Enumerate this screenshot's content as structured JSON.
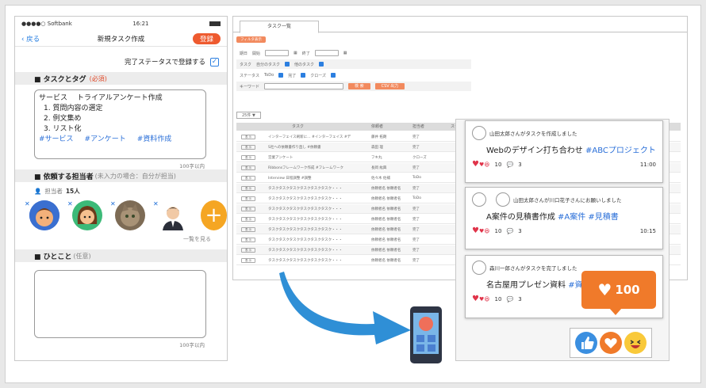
{
  "phone": {
    "status": {
      "carrier": "●●●●○ Softbank",
      "time": "16:21"
    },
    "nav": {
      "back": "戻る",
      "title": "新規タスク作成",
      "register": "登録"
    },
    "register_complete_label": "完了ステータスで登録する",
    "section_task": {
      "title": "■ タスクとタグ",
      "required": "(必須)"
    },
    "task_text": {
      "service_label": "サービス",
      "service_value": "トライアルアンケート作成",
      "items": [
        "1. 質問内容の選定",
        "2. 例文集め",
        "3. リスト化"
      ],
      "tags": [
        "#サービス",
        "#アンケート",
        "#資料作成"
      ]
    },
    "char_limit": "100字以内",
    "section_assignee": {
      "title": "■ 依頼する担当者",
      "note": "(未入力の場合：自分が担当)"
    },
    "assignee_count_label": "担当者",
    "assignee_count": "15人",
    "view_all": "一覧を見る",
    "section_comment": {
      "title": "■ ひとこと",
      "note": "(任意)"
    },
    "comment_limit": "100字以内"
  },
  "web": {
    "tab": "タスク一覧",
    "top_button": "フィルタ表示",
    "filters": {
      "date_label": "期日",
      "start": "開始",
      "end": "終了",
      "task_label": "タスク",
      "task_opt1": "自分のタスク",
      "task_opt2": "他のタスク",
      "status_label": "ステータス",
      "status_opt1": "ToDo",
      "status_opt2": "完了",
      "status_opt3": "クローズ",
      "keyword_label": "キーワード",
      "search": "検 索",
      "csv": "CSV 出力"
    },
    "page_label": "25件 ▼",
    "table": {
      "headers": [
        "タスク",
        "依頼者",
        "担当者",
        "ステータス"
      ],
      "btn": "表 示",
      "rows": [
        {
          "task": "インターフェイス刷新に… #インターフェイス #デ",
          "req": "藤井 拓朗",
          "st": "完了"
        },
        {
          "task": "S社への依頼書作り直し #依頼書",
          "req": "森田 理",
          "st": "完了"
        },
        {
          "task": "営業アンケート",
          "req": "フキ丸",
          "st": "クローズ"
        },
        {
          "task": "Ribbonsフレームワーク作成 #フレームワーク",
          "req": "長岡 紘興",
          "st": "完了"
        },
        {
          "task": "Interview 日程調整 #調整",
          "req": "佐々木 佐補",
          "st": "ToDo"
        },
        {
          "task": "タスクタスクタスクタスクタスクタスク・・・",
          "req": "依頼者名 依頼者名",
          "st": "完了"
        },
        {
          "task": "タスクタスクタスクタスクタスクタスク・・・",
          "req": "依頼者名 依頼者名",
          "st": "ToDo"
        },
        {
          "task": "タスクタスクタスクタスクタスクタスク・・・",
          "req": "依頼者名 依頼者名",
          "st": "完了"
        },
        {
          "task": "タスクタスクタスクタスクタスクタスク・・・",
          "req": "依頼者名 依頼者名",
          "st": "完了"
        },
        {
          "task": "タスクタスクタスクタスクタスクタスク・・・",
          "req": "依頼者名 依頼者名",
          "st": "完了"
        },
        {
          "task": "タスクタスクタスクタスクタスクタスク・・・",
          "req": "依頼者名 依頼者名",
          "st": "完了"
        },
        {
          "task": "タスクタスクタスクタスクタスクタスク・・・",
          "req": "依頼者名 依頼者名",
          "st": "完了"
        },
        {
          "task": "タスクタスクタスクタスクタスクタスク・・・",
          "req": "依頼者名 依頼者名",
          "st": "完了"
        }
      ]
    }
  },
  "cards": [
    {
      "actor": "山田太郎さんがタスクを作成しました",
      "title": "Webのデザイン打ち合わせ",
      "tag": "#ABCプロジェクト",
      "likes": "10",
      "comments": "3",
      "time": "11:00"
    },
    {
      "actor": "山田太郎さんが川口花子さんにお願いしました",
      "title": "A案件の見積書作成",
      "tag": "#A案件 #見積書",
      "likes": "10",
      "comments": "3",
      "time": "10:15"
    },
    {
      "actor": "森川一郎さんがタスクを完了しました",
      "title": "名古屋用プレゼン資料",
      "tag": "#資料",
      "likes": "10",
      "comments": "3",
      "time": ""
    }
  ],
  "reaction_count": "100",
  "colors": {
    "accent_orange": "#ee5a2f",
    "link_blue": "#1f7ae0",
    "arrow_blue": "#2f8fd6",
    "bubble_orange": "#f07a2a"
  }
}
